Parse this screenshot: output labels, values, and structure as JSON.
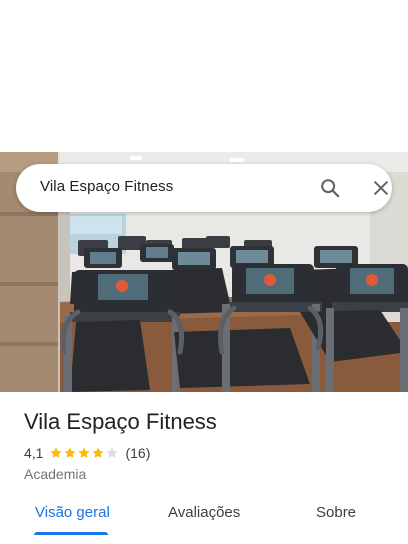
{
  "search": {
    "query": "Vila Espaço Fitness"
  },
  "icons": {
    "search": "search-icon",
    "close": "close-icon",
    "star": "star-icon"
  },
  "place": {
    "name": "Vila Espaço Fitness",
    "rating": "4,1",
    "rating_value": 4.1,
    "stars_max": 5,
    "reviews": "(16)",
    "category": "Academia"
  },
  "tabs": [
    {
      "label": "Visão geral",
      "active": true
    },
    {
      "label": "Avaliações",
      "active": false
    },
    {
      "label": "Sobre",
      "active": false
    }
  ],
  "colors": {
    "accent": "#1a73e8",
    "star": "#fbbc04",
    "star_empty": "#dadce0"
  }
}
